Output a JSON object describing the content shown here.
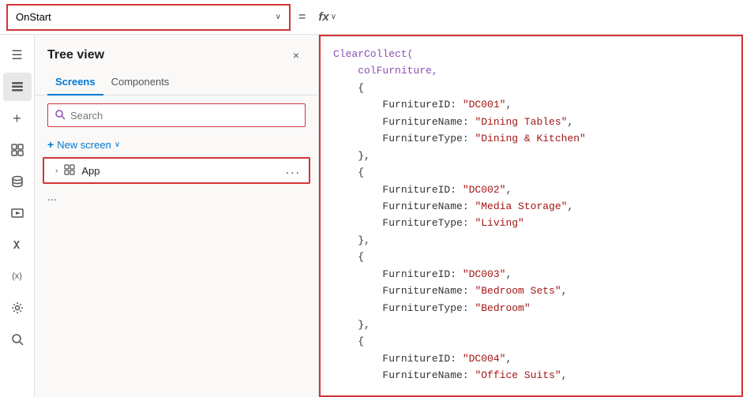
{
  "topbar": {
    "property_label": "OnStart",
    "equals": "=",
    "fx_label": "fx",
    "fx_chevron": "∨"
  },
  "sidebar": {
    "icons": [
      {
        "name": "hamburger-menu-icon",
        "symbol": "☰"
      },
      {
        "name": "layers-icon",
        "symbol": "⬡"
      },
      {
        "name": "add-icon",
        "symbol": "+"
      },
      {
        "name": "components-icon",
        "symbol": "⬜"
      },
      {
        "name": "data-icon",
        "symbol": "🗄"
      },
      {
        "name": "media-icon",
        "symbol": "♪"
      },
      {
        "name": "formula-icon",
        "symbol": "≈"
      },
      {
        "name": "variables-icon",
        "symbol": "(x)"
      },
      {
        "name": "settings-icon",
        "symbol": "⚙"
      },
      {
        "name": "search-icon-sidebar",
        "symbol": "🔍"
      }
    ]
  },
  "tree_view": {
    "title": "Tree view",
    "close_label": "×",
    "tabs": [
      {
        "id": "screens",
        "label": "Screens",
        "active": true
      },
      {
        "id": "components",
        "label": "Components",
        "active": false
      }
    ],
    "search_placeholder": "Search",
    "new_screen_label": "New screen",
    "app_item": {
      "label": "App",
      "menu_label": "..."
    },
    "more_label": "..."
  },
  "code": {
    "lines": [
      {
        "parts": [
          {
            "cls": "fn",
            "text": "ClearCollect("
          }
        ]
      },
      {
        "parts": [
          {
            "cls": "fn",
            "text": "    colFurniture,"
          }
        ]
      },
      {
        "parts": [
          {
            "cls": "punc",
            "text": "    {"
          }
        ]
      },
      {
        "parts": [
          {
            "cls": "prop",
            "text": "        FurnitureID: "
          },
          {
            "cls": "str",
            "text": "\"DC001\""
          },
          {
            "cls": "punc",
            "text": ","
          }
        ]
      },
      {
        "parts": [
          {
            "cls": "prop",
            "text": "        FurnitureName: "
          },
          {
            "cls": "str",
            "text": "\"Dining Tables\""
          },
          {
            "cls": "punc",
            "text": ","
          }
        ]
      },
      {
        "parts": [
          {
            "cls": "prop",
            "text": "        FurnitureType: "
          },
          {
            "cls": "str",
            "text": "\"Dining & Kitchen\""
          }
        ]
      },
      {
        "parts": [
          {
            "cls": "punc",
            "text": "    },"
          }
        ]
      },
      {
        "parts": [
          {
            "cls": "punc",
            "text": "    {"
          }
        ]
      },
      {
        "parts": [
          {
            "cls": "punc",
            "text": ""
          }
        ]
      },
      {
        "parts": [
          {
            "cls": "prop",
            "text": "        FurnitureID: "
          },
          {
            "cls": "str",
            "text": "\"DC002\""
          },
          {
            "cls": "punc",
            "text": ","
          }
        ]
      },
      {
        "parts": [
          {
            "cls": "prop",
            "text": "        FurnitureName: "
          },
          {
            "cls": "str",
            "text": "\"Media Storage\""
          },
          {
            "cls": "punc",
            "text": ","
          }
        ]
      },
      {
        "parts": [
          {
            "cls": "prop",
            "text": "        FurnitureType: "
          },
          {
            "cls": "str",
            "text": "\"Living\""
          }
        ]
      },
      {
        "parts": [
          {
            "cls": "punc",
            "text": "    },"
          }
        ]
      },
      {
        "parts": [
          {
            "cls": "punc",
            "text": "    {"
          }
        ]
      },
      {
        "parts": [
          {
            "cls": "punc",
            "text": ""
          }
        ]
      },
      {
        "parts": [
          {
            "cls": "prop",
            "text": "        FurnitureID: "
          },
          {
            "cls": "str",
            "text": "\"DC003\""
          },
          {
            "cls": "punc",
            "text": ","
          }
        ]
      },
      {
        "parts": [
          {
            "cls": "prop",
            "text": "        FurnitureName: "
          },
          {
            "cls": "str",
            "text": "\"Bedroom Sets\""
          },
          {
            "cls": "punc",
            "text": ","
          }
        ]
      },
      {
        "parts": [
          {
            "cls": "prop",
            "text": "        FurnitureType: "
          },
          {
            "cls": "str",
            "text": "\"Bedroom\""
          }
        ]
      },
      {
        "parts": [
          {
            "cls": "punc",
            "text": "    },"
          }
        ]
      },
      {
        "parts": [
          {
            "cls": "punc",
            "text": "    {"
          }
        ]
      },
      {
        "parts": [
          {
            "cls": "punc",
            "text": ""
          }
        ]
      },
      {
        "parts": [
          {
            "cls": "prop",
            "text": "        FurnitureID: "
          },
          {
            "cls": "str",
            "text": "\"DC004\""
          },
          {
            "cls": "punc",
            "text": ","
          }
        ]
      },
      {
        "parts": [
          {
            "cls": "prop",
            "text": "        FurnitureName: "
          },
          {
            "cls": "str",
            "text": "\"Office Suits\""
          },
          {
            "cls": "punc",
            "text": ","
          }
        ]
      }
    ]
  }
}
